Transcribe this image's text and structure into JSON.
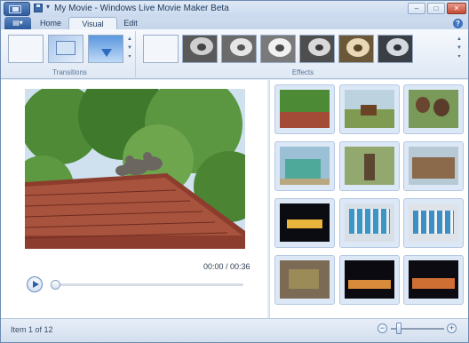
{
  "window": {
    "title": "My Movie - Windows Live Movie Maker Beta",
    "minimize_glyph": "–",
    "maximize_glyph": "□",
    "close_glyph": "✕"
  },
  "quick_access": {
    "dropdown_glyph": "▾"
  },
  "tabs": [
    {
      "label": "Home"
    },
    {
      "label": "Visual Effects"
    },
    {
      "label": "Edit"
    }
  ],
  "help_glyph": "?",
  "ribbon": {
    "groups": [
      {
        "label": "Transitions"
      },
      {
        "label": "Effects"
      }
    ]
  },
  "player": {
    "timecode": "00:00 / 00:36"
  },
  "storyboard": {
    "clips": [
      {
        "subject": "monkeys on roof"
      },
      {
        "subject": "cart by lake"
      },
      {
        "subject": "smiling kids"
      },
      {
        "subject": "green shrine"
      },
      {
        "subject": "man by car"
      },
      {
        "subject": "hut"
      },
      {
        "subject": "lit palace"
      },
      {
        "subject": "exhibit panels 1"
      },
      {
        "subject": "exhibit panels 2"
      },
      {
        "subject": "carving"
      },
      {
        "subject": "night lights 1"
      },
      {
        "subject": "night lights 2"
      }
    ]
  },
  "status": {
    "item_text": "Item 1 of 12",
    "zoom_out_glyph": "−",
    "zoom_in_glyph": "+"
  },
  "colors": {
    "accent": "#3f74c1",
    "ribbon_bg": "#e4ecf7",
    "selected_tab": "#eef3fa"
  }
}
